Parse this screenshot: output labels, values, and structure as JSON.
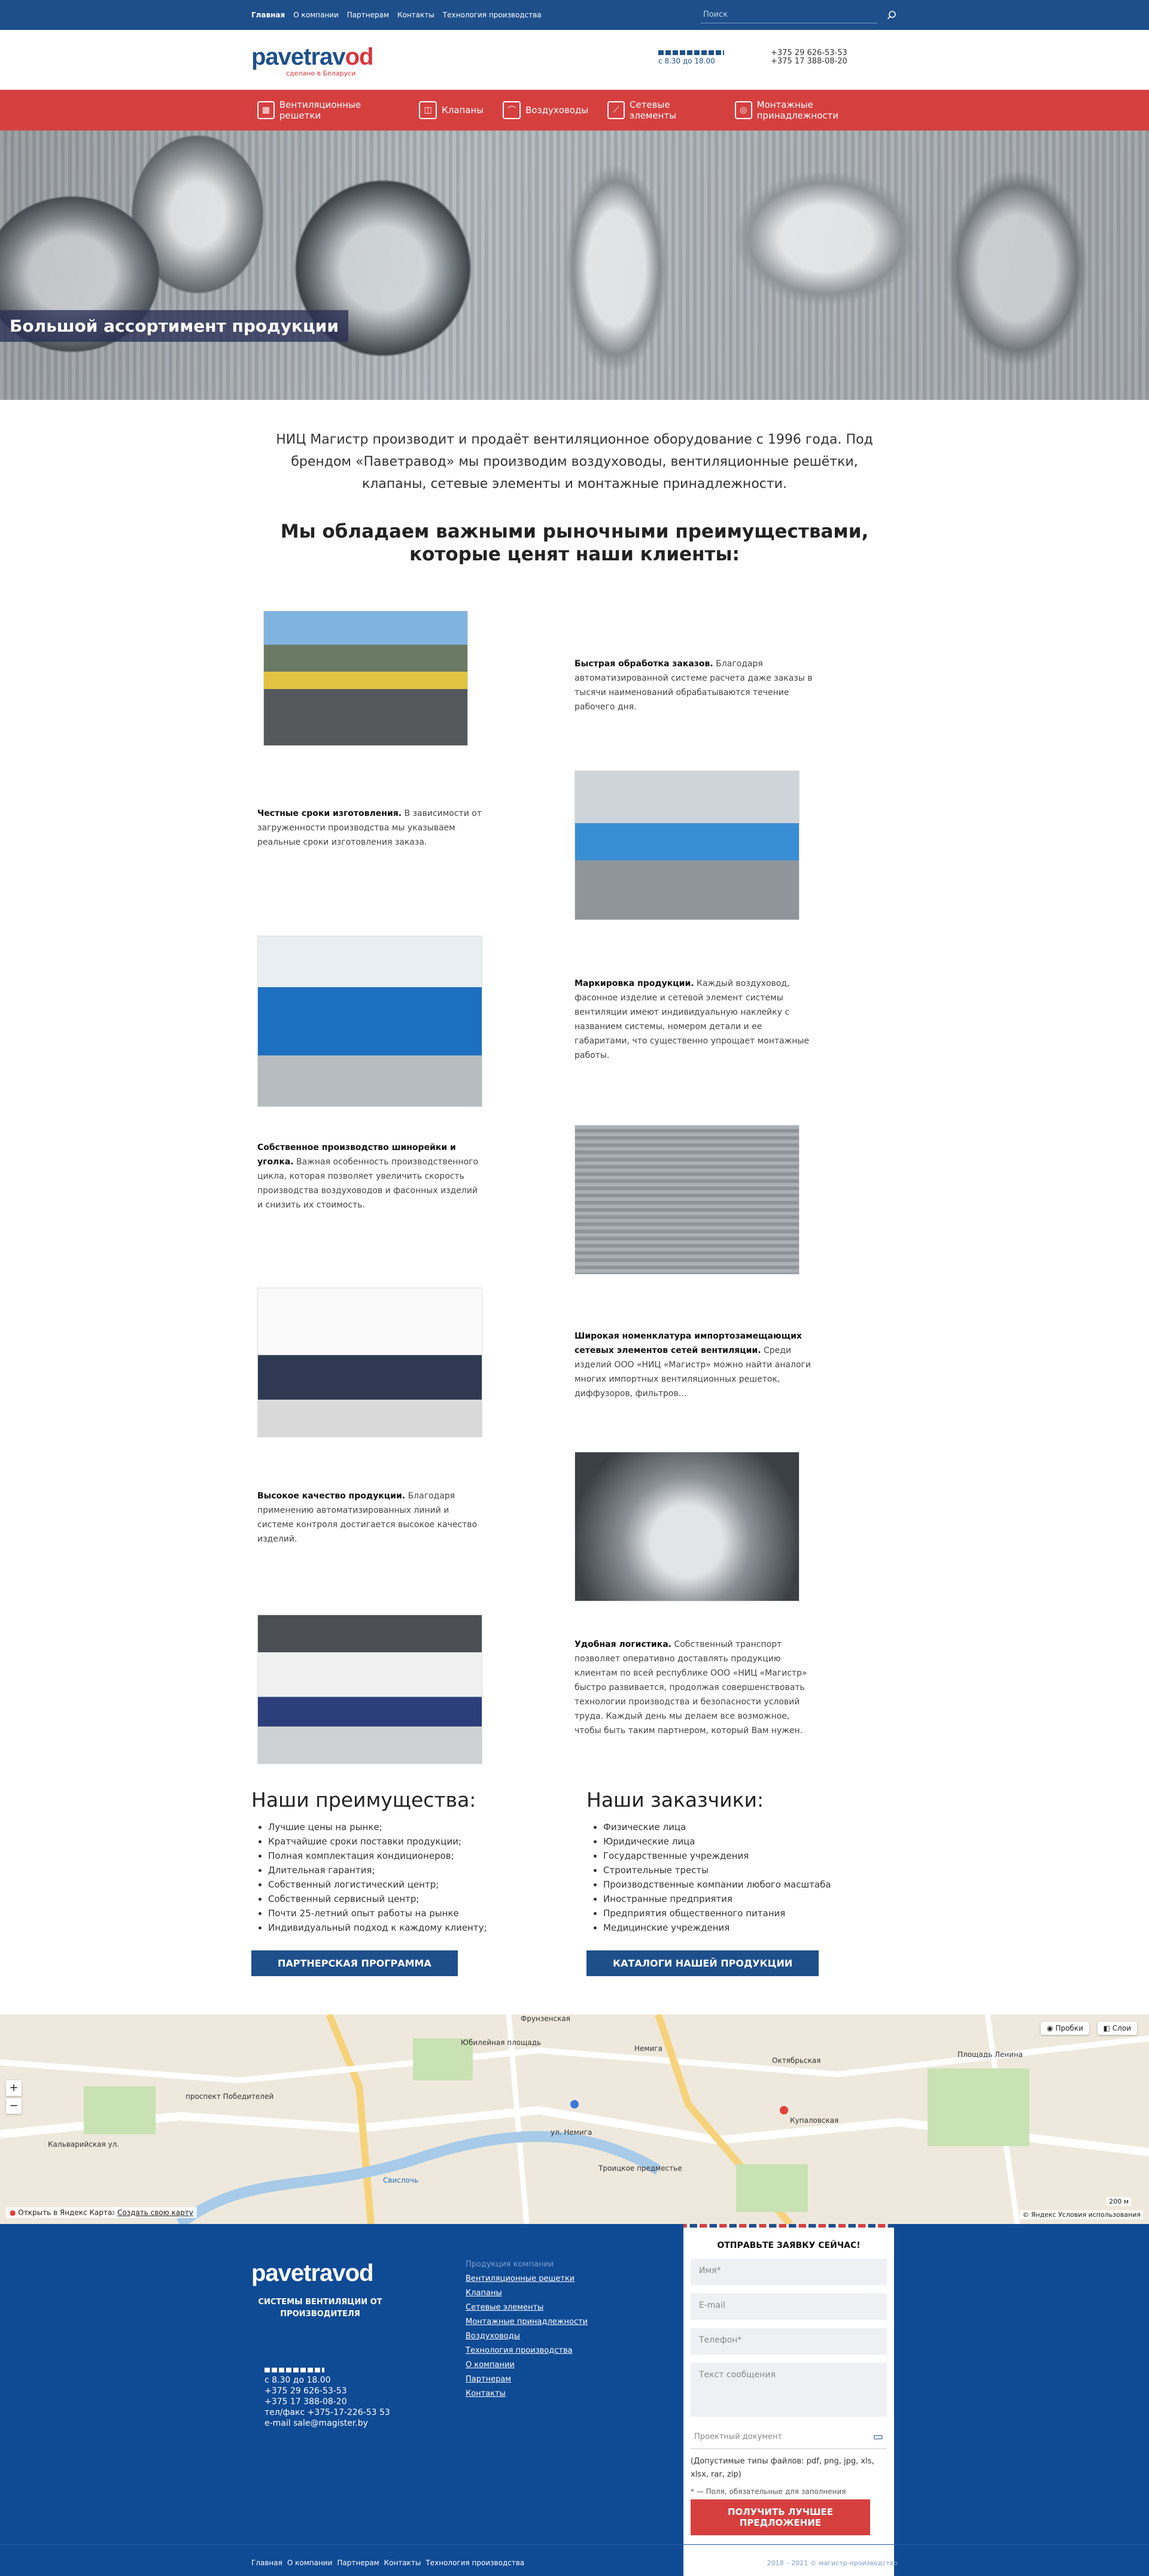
{
  "topnav": {
    "items": [
      "Главная",
      "О компании",
      "Партнерам",
      "Контакты",
      "Технология производства"
    ],
    "search_placeholder": "Поиск"
  },
  "header": {
    "logo_main": "pavetrav",
    "logo_end": "od",
    "logo_tag": "сделано в Беларуси",
    "hours": "с 8.30 до 18.00",
    "phone1": "+375 29 626-53-53",
    "phone2": "+375 17 388-08-20"
  },
  "catnav": {
    "items": [
      {
        "label": "Вентиляционные решетки",
        "icon": "grille-icon"
      },
      {
        "label": "Клапаны",
        "icon": "valve-icon"
      },
      {
        "label": "Воздуховоды",
        "icon": "duct-icon"
      },
      {
        "label": "Сетевые элементы",
        "icon": "network-element-icon"
      },
      {
        "label": "Монтажные принадлежности",
        "icon": "mounting-icon"
      }
    ]
  },
  "hero": {
    "caption": "Большой ассортимент продукции"
  },
  "intro": "НИЦ Магистр производит и продаёт вентиляционное оборудование с 1996 года. Под брендом «Паветравод» мы производим воздуховоды, вентиляционные решётки, клапаны, сетевые элементы и монтажные принадлежности.",
  "advantages_heading": "Мы обладаем важными рыночными преимуществами, которые ценят наши клиенты:",
  "features": [
    {
      "title": "Быстрая обработка заказов.",
      "text": " Благодаря автоматизированной системе расчета даже заказы в тысячи наименований обрабатываются течение рабочего дня."
    },
    {
      "title": "Честные сроки изготовления.",
      "text": " В зависимости от загруженности производства мы указываем реальные сроки изготовления заказа."
    },
    {
      "title": "Маркировка продукции.",
      "text": " Каждый воздуховод, фасонное изделие и сетевой элемент системы вентиляции имеют индивидуальную наклейку с названием системы, номером детали и ее габаритами, что существенно упрощает монтажные работы."
    },
    {
      "title": "Собственное производство шинорейки и уголка.",
      "text": " Важная особенность производственного цикла, которая позволяет увеличить скорость производства воздуховодов и фасонных изделий и снизить их стоимость."
    },
    {
      "title": "Широкая номенклатура импортозамещающих сетевых элементов сетей вентиляции.",
      "text": " Среди изделий ООО «НИЦ «Магистр» можно найти аналоги многих импортных вентиляционных решеток, диффузоров, фильтров…"
    },
    {
      "title": "Высокое качество продукции.",
      "text": " Благодаря применению автоматизированных линий и системе контроля достигается высокое качество изделий."
    },
    {
      "title": "Удобная логистика.",
      "text": " Собственный транспорт позволяет оперативно доставлять продукцию клиентам по всей республике ООО «НИЦ «Магистр» быстро развивается, продолжая совершенствовать технологии производства и безопасности условий труда. Каждый день мы делаем все возможное, чтобы быть таким партнером, который Вам нужен."
    }
  ],
  "our_advantages": {
    "title": "Наши преимущества:",
    "items": [
      "Лучшие цены на рынке;",
      "Кратчайшие сроки поставки продукции;",
      "Полная комплектация кондиционеров;",
      "Длительная гарантия;",
      "Собственный логистический центр;",
      "Собственный сервисный центр;",
      "Почти 25-летний опыт работы на рынке",
      "Индивидуальный подход к каждому клиенту;"
    ],
    "button": "ПАРТНЕРСКАЯ ПРОГРАММА"
  },
  "customers": {
    "title": "Наши заказчики:",
    "items": [
      "Физические лица",
      "Юридические лица",
      "Государственные учреждения",
      "Строительные тресты",
      "Производственные компании любого масштаба",
      "Иностранные предприятия",
      "Предприятия общественного питания",
      "Медицинские учреждения"
    ],
    "button": "КАТАЛОГИ НАШЕЙ ПРОДУКЦИИ"
  },
  "map": {
    "traffic": "Пробки",
    "layers": "Слои",
    "open_link": "Открыть в Яндекс Картах",
    "create_link": "Создать свою карту",
    "scale": "200 м",
    "copyright": "© Яндекс Условия использования",
    "labels": [
      "Фрунзенская",
      "Юбилейная площадь",
      "Немига",
      "Октябрьская",
      "Купаловская",
      "Площадь Ленина",
      "Троицкое предместье",
      "ул. Немига",
      "Свислочь",
      "проспект Победителей",
      "Кальварийская ул."
    ]
  },
  "footer": {
    "logo_main": "pavetrav",
    "logo_end": "od",
    "subtitle": "СИСТЕМЫ ВЕНТИЛЯЦИИ ОТ ПРОИЗВОДИТЕЛЯ",
    "hours": "с 8.30 до 18.00",
    "phone1": "+375 29 626-53-53",
    "phone2": "+375 17 388-08-20",
    "fax": "тел/факс +375-17-226-53 53",
    "email": "e-mail sale@magister.by",
    "links_title": "Продукция компании",
    "links": [
      "Вентиляционные решетки",
      "Клапаны",
      "Сетевые элементы",
      "Монтажные принадлежности",
      "Воздуховоды",
      "Технология производства",
      "О компании",
      "Партнерам",
      "Контакты"
    ],
    "bottom_nav": [
      "Главная",
      "О компании",
      "Партнерам",
      "Контакты",
      "Технология производства"
    ],
    "copyright": "2018 – 2021 © магистр-производство"
  },
  "form": {
    "title": "ОТПРАВЬТЕ ЗАЯВКУ СЕЙЧАС!",
    "name_placeholder": "Имя*",
    "email_placeholder": "E-mail",
    "phone_placeholder": "Телефон*",
    "message_placeholder": "Текст сообщения",
    "file_placeholder": "Проектный документ",
    "file_types": "(Допустимые типы файлов: pdf, png, jpg, xls, xlsx, rar, zip)",
    "required_note": "* — Поля, обязательные для заполнения",
    "submit": "ПОЛУЧИТЬ ЛУЧШЕЕ ПРЕДЛОЖЕНИЕ"
  }
}
